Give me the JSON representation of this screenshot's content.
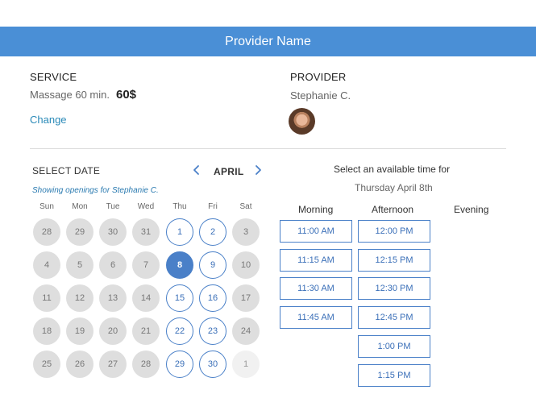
{
  "header": {
    "title": "Provider Name"
  },
  "service": {
    "label": "SERVICE",
    "name": "Massage 60 min.",
    "price": "60$",
    "change": "Change"
  },
  "provider": {
    "label": "PROVIDER",
    "name": "Stephanie C."
  },
  "calendar": {
    "title": "SELECT DATE",
    "month": "APRIL",
    "showing": "Showing openings for Stephanie C.",
    "weekdays": [
      "Sun",
      "Mon",
      "Tue",
      "Wed",
      "Thu",
      "Fri",
      "Sat"
    ],
    "weeks": [
      [
        {
          "d": "28",
          "s": "dis"
        },
        {
          "d": "29",
          "s": "dis"
        },
        {
          "d": "30",
          "s": "dis"
        },
        {
          "d": "31",
          "s": "dis"
        },
        {
          "d": "1",
          "s": "avail"
        },
        {
          "d": "2",
          "s": "avail"
        },
        {
          "d": "3",
          "s": "dis"
        }
      ],
      [
        {
          "d": "4",
          "s": "dis"
        },
        {
          "d": "5",
          "s": "dis"
        },
        {
          "d": "6",
          "s": "dis"
        },
        {
          "d": "7",
          "s": "dis"
        },
        {
          "d": "8",
          "s": "sel"
        },
        {
          "d": "9",
          "s": "avail"
        },
        {
          "d": "10",
          "s": "dis"
        }
      ],
      [
        {
          "d": "11",
          "s": "dis"
        },
        {
          "d": "12",
          "s": "dis"
        },
        {
          "d": "13",
          "s": "dis"
        },
        {
          "d": "14",
          "s": "dis"
        },
        {
          "d": "15",
          "s": "avail"
        },
        {
          "d": "16",
          "s": "avail"
        },
        {
          "d": "17",
          "s": "dis"
        }
      ],
      [
        {
          "d": "18",
          "s": "dis"
        },
        {
          "d": "19",
          "s": "dis"
        },
        {
          "d": "20",
          "s": "dis"
        },
        {
          "d": "21",
          "s": "dis"
        },
        {
          "d": "22",
          "s": "avail"
        },
        {
          "d": "23",
          "s": "avail"
        },
        {
          "d": "24",
          "s": "dis"
        }
      ],
      [
        {
          "d": "25",
          "s": "dis"
        },
        {
          "d": "26",
          "s": "dis"
        },
        {
          "d": "27",
          "s": "dis"
        },
        {
          "d": "28",
          "s": "dis"
        },
        {
          "d": "29",
          "s": "avail"
        },
        {
          "d": "30",
          "s": "avail"
        },
        {
          "d": "1",
          "s": "faint"
        }
      ]
    ]
  },
  "times": {
    "prompt": "Select an available time for",
    "date": "Thursday April 8th",
    "morning_label": "Morning",
    "afternoon_label": "Afternoon",
    "evening_label": "Evening",
    "morning": [
      "11:00 AM",
      "11:15 AM",
      "11:30 AM",
      "11:45 AM"
    ],
    "afternoon": [
      "12:00 PM",
      "12:15 PM",
      "12:30 PM",
      "12:45 PM",
      "1:00 PM",
      "1:15 PM"
    ],
    "evening": []
  },
  "colors": {
    "accent": "#4a80c8",
    "header": "#4a8fd6",
    "link": "#2a8ab8",
    "disabled": "#dedede"
  },
  "icons": {
    "prev": "chevron-left-icon",
    "next": "chevron-right-icon"
  }
}
